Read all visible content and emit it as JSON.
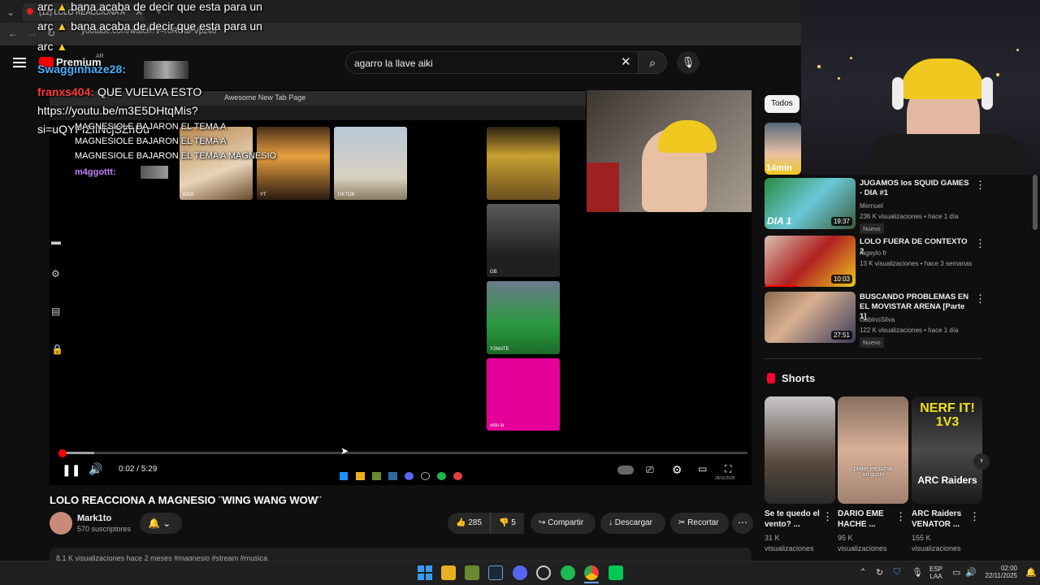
{
  "browser": {
    "tab_title": "(12) LOLO REACCIONA A",
    "url": "youtube.com/watch?v=roROaFVpz48"
  },
  "chat": {
    "line1_user": "arc",
    "line1_text": "bana acaba de decir que esta para un",
    "line2_user": "arc",
    "line2_text": "bana acaba de decir que esta para un",
    "line3_user": "arc",
    "line4_user": "Swagginhaze28:",
    "line5_user": "franxs404:",
    "line5_text": "QUE VUELVA ESTO",
    "line6_text": "https://youtu.be/m3E5DHtqMis?",
    "line7_text": "si=uQYFIZIiNcjSZnUu",
    "inner1": "MAGNESIOLE BAJARON EL TEMA A",
    "inner2": "MAGNESIOLE BAJARON EL TEMA A",
    "inner3": "MAGNESIOLE BAJARON EL TEMA A MAGNESIO",
    "inner4_user": "m4ggottt:"
  },
  "yt": {
    "premium": "Premium",
    "premium_region": "AR",
    "search_value": "agarro la llave aiki"
  },
  "player": {
    "inner_tab": "Awesome New Tab Page",
    "tile_labels": [
      "KICK",
      "YT",
      "TIKTOK",
      "",
      "GB",
      "Y2MATE",
      "vidu ia"
    ],
    "time": "0:02 / 5:29",
    "progress_fraction": 0.004,
    "buffer_fraction": 0.05,
    "clock_mini": "28/11/2025"
  },
  "video": {
    "title": "LOLO REACCIONA A MAGNESIO ¨WING WANG WOW¨",
    "channel": "Mark1to",
    "subscribers": "570 suscriptores",
    "likes": "285",
    "dislikes": "5",
    "share": "Compartir",
    "download": "Descargar",
    "clip": "Recortar",
    "desc_preview": "8,1 K visualizaciones  hace 2 meses  #magnesio #stream #musica"
  },
  "sidebar": {
    "chip": "Todos",
    "first_duration": "14min",
    "recs": [
      {
        "title": "JUGAMOS los SQUID GAMES - DIA #1",
        "channel": "Mernuel",
        "meta": "236 K visualizaciones • hace 1 día",
        "badge": "Nuevo",
        "duration": "19:37",
        "overlay": "DIA 1"
      },
      {
        "title": "LOLO FUERA DE CONTEXTO 2",
        "channel": "rageylo fr",
        "meta": "13 K visualizaciones • hace 3 semanas",
        "badge": "",
        "duration": "10:03",
        "overlay": ""
      },
      {
        "title": "BUSCANDO PROBLEMAS EN EL MOVISTAR ARENA [Parte 1]",
        "channel": "GabinoSilva",
        "meta": "122 K visualizaciones • hace 1 día",
        "badge": "Nuevo",
        "duration": "27:51",
        "overlay": ""
      }
    ],
    "shorts_heading": "Shorts",
    "shorts": [
      {
        "title": "Se te quedo el vento? ...",
        "views": "31 K",
        "views_label": "visualizaciones"
      },
      {
        "title": "DARIO EME HACHE ...",
        "views": "95 K",
        "views_label": "visualizaciones"
      },
      {
        "title": "ARC Raiders VENATOR ...",
        "views": "155 K",
        "views_label": "visualizaciones",
        "overlay": "NERF IT! 1V3",
        "overlay2": "ARC Raiders"
      }
    ],
    "short2_caption": "poder escuchar un gusto"
  },
  "taskbar": {
    "lang": "ESP",
    "lang2": "LAA",
    "time": "02:00",
    "date": "22/11/2025"
  },
  "colors": {
    "accent_red": "#ff0000",
    "spotify": "#1db954",
    "pink_tile": "#e6009a"
  }
}
